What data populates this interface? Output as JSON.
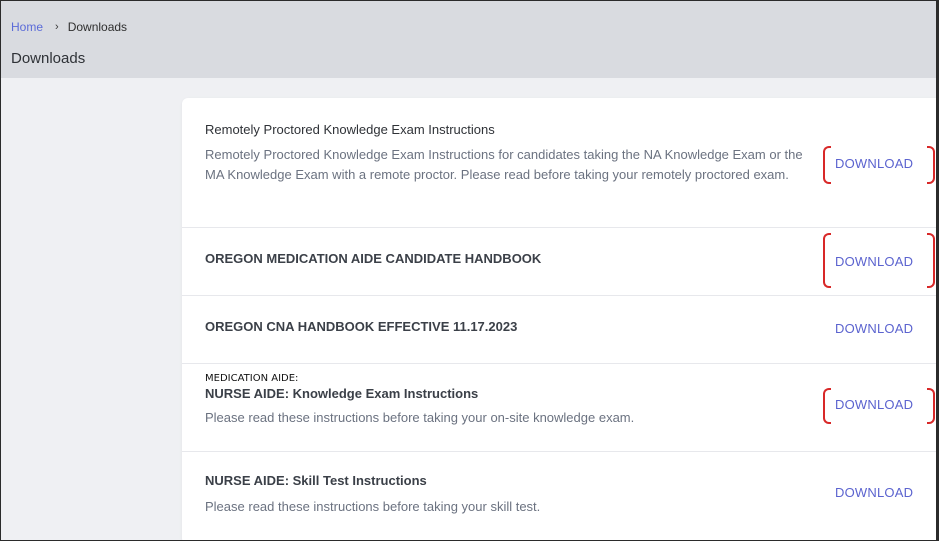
{
  "breadcrumb": {
    "home": "Home",
    "separator": "›",
    "current": "Downloads"
  },
  "page_title": "Downloads",
  "downloads": [
    {
      "title": "Remotely Proctored Knowledge Exam Instructions",
      "description": "Remotely Proctored Knowledge Exam Instructions for candidates taking the NA Knowledge Exam or the MA Knowledge Exam with a remote proctor. Please read before taking your remotely proctored exam.",
      "action": "DOWNLOAD"
    },
    {
      "title": "OREGON MEDICATION AIDE CANDIDATE HANDBOOK",
      "action": "DOWNLOAD"
    },
    {
      "title": "OREGON CNA HANDBOOK EFFECTIVE 11.17.2023",
      "action": "DOWNLOAD"
    },
    {
      "pre_label": "MEDICATION AIDE:",
      "title": "NURSE AIDE: Knowledge Exam Instructions",
      "description": "Please read these instructions before taking your on-site knowledge exam.",
      "action": "DOWNLOAD"
    },
    {
      "title": "NURSE AIDE: Skill Test Instructions",
      "description": "Please read these instructions before taking your skill test.",
      "action": "DOWNLOAD"
    }
  ],
  "annotation_color": "#d82828",
  "link_color": "#5b63cf"
}
